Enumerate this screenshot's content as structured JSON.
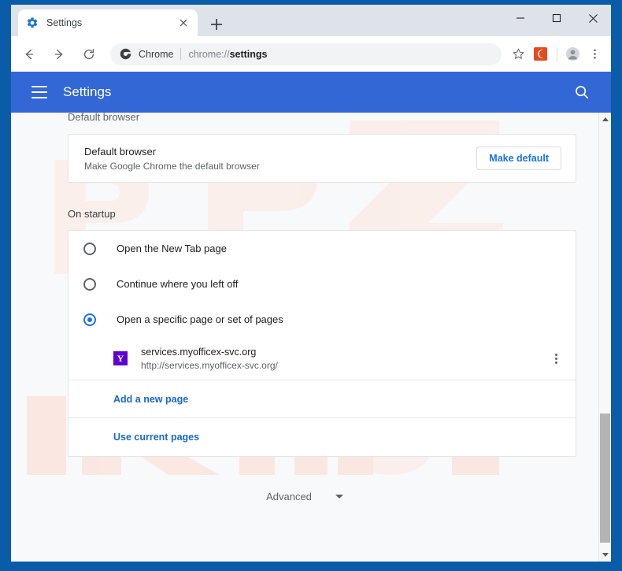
{
  "window": {
    "controls": {
      "minimize": "minimize-button",
      "maximize": "maximize-button",
      "close": "close-button"
    }
  },
  "tabs": [
    {
      "title": "Settings",
      "favicon": "gear-icon",
      "close": "close-icon",
      "active": true
    }
  ],
  "new_tab_label": "+",
  "toolbar": {
    "back": "back-arrow-icon",
    "forward": "forward-arrow-icon",
    "reload": "reload-icon",
    "omnibox": {
      "chip_icon": "chrome-logo-icon",
      "chip_label": "Chrome",
      "url_scheme": "chrome://",
      "url_path": "settings",
      "full_url": "chrome://settings"
    },
    "bookmark": "star-icon",
    "extension": "extension-icon",
    "profile": "avatar-icon",
    "menu": "three-dot-menu-icon"
  },
  "settings_header": {
    "menu_icon": "hamburger-icon",
    "title": "Settings",
    "search_icon": "search-icon"
  },
  "content": {
    "default_browser": {
      "heading": "Default browser",
      "row_title": "Default browser",
      "row_subtitle": "Make Google Chrome the default browser",
      "button_label": "Make default"
    },
    "on_startup": {
      "heading": "On startup",
      "options": [
        {
          "label": "Open the New Tab page",
          "selected": false
        },
        {
          "label": "Continue where you left off",
          "selected": false
        },
        {
          "label": "Open a specific page or set of pages",
          "selected": true
        }
      ],
      "pages": [
        {
          "favicon_letter": "Y",
          "favicon_color": "#6001d2",
          "title": "services.myofficex-svc.org",
          "url": "http://services.myofficex-svc.org/",
          "menu_icon": "three-dot-menu-icon"
        }
      ],
      "add_page_link": "Add a new page",
      "use_current_link": "Use current pages"
    },
    "advanced": {
      "label": "Advanced",
      "chevron": "chevron-down-icon"
    }
  },
  "watermark": {
    "text": "PCrisk.com"
  },
  "colors": {
    "frame_blue": "#0a5ca8",
    "header_blue": "#3367d6",
    "link_blue": "#1967d2",
    "accent_blue": "#1a73e8",
    "favicon_purple": "#6001d2",
    "extension_orange": "#e8491e",
    "content_bg": "#f8f9fa"
  }
}
